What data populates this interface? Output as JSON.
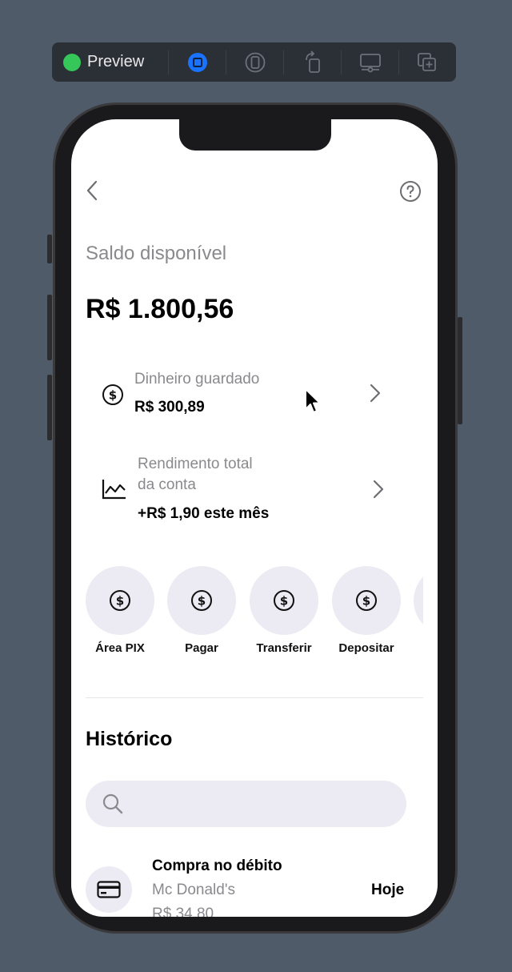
{
  "toolbar": {
    "title": "Preview",
    "colors": {
      "status_dot": "#35c759",
      "selected": "#1a73ff"
    }
  },
  "screen": {
    "balance_label": "Saldo disponível",
    "balance_value": "R$ 1.800,56",
    "saved_money": {
      "title": "Dinheiro guardado",
      "value": "R$ 300,89"
    },
    "yield": {
      "title_line1": "Rendimento total",
      "title_line2": "da conta",
      "value": "+R$ 1,90 este mês"
    },
    "actions": [
      {
        "label": "Área PIX",
        "icon": "dollar-circle-icon"
      },
      {
        "label": "Pagar",
        "icon": "dollar-circle-icon"
      },
      {
        "label": "Transferir",
        "icon": "dollar-circle-icon"
      },
      {
        "label": "Depositar",
        "icon": "dollar-circle-icon"
      }
    ],
    "history": {
      "title": "Histórico",
      "search_placeholder": "",
      "transactions": [
        {
          "title": "Compra no débito",
          "merchant": "Mc Donald's",
          "amount": "R$ 34,80",
          "date": "Hoje",
          "icon": "credit-card-icon"
        }
      ]
    }
  }
}
